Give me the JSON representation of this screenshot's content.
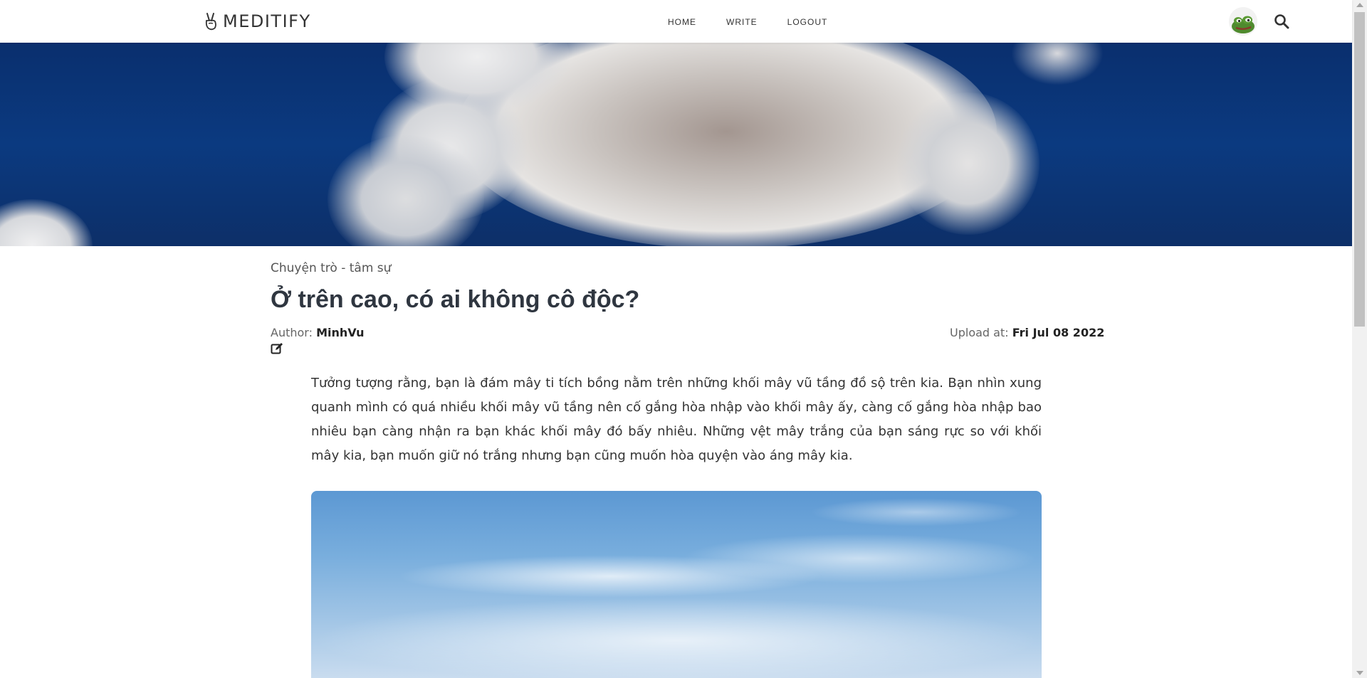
{
  "brand": {
    "name": "MEDITIFY",
    "icon": "victory-hand-icon"
  },
  "nav": {
    "links": [
      "HOME",
      "WRITE",
      "LOGOUT"
    ]
  },
  "user": {
    "avatar": "frog-avatar"
  },
  "icons": {
    "search": "search-icon",
    "edit": "edit-icon"
  },
  "article": {
    "category": "Chuyện trò - tâm sự",
    "title": "Ở trên cao, có ai không cô độc?",
    "author_label": "Author:",
    "author": "MinhVu",
    "upload_label": "Upload at:",
    "upload_date": "Fri Jul 08 2022",
    "body": "Tưởng tượng rằng, bạn là đám mây ti tích bồng nằm trên những khối mây vũ tầng đồ sộ trên kia. Bạn nhìn xung quanh mình có quá nhiều khối mây vũ tầng nên cố gắng hòa nhập vào khối mây ấy, càng cố gắng hòa nhập bao nhiêu bạn càng nhận ra bạn khác khối mây đó bấy nhiêu. Những vệt mây trắng của bạn sáng rực so với khối mây kia, bạn muốn giữ nó trắng nhưng bạn cũng muốn hòa quyện vào áng mây kia."
  },
  "colors": {
    "hero_sky": "#0b3a80",
    "title": "#2f3640",
    "image_sky": "#6aa5da"
  }
}
